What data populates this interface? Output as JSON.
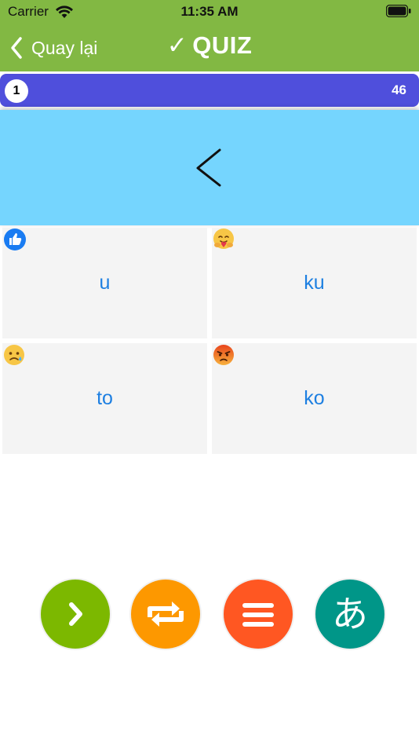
{
  "status": {
    "carrier": "Carrier",
    "time": "11:35 AM"
  },
  "nav": {
    "back_label": "Quay lại",
    "title_check": "✓",
    "title": "QUIZ"
  },
  "progress": {
    "current": "1",
    "total": "46"
  },
  "question": {
    "glyph": "ku-hiragana"
  },
  "answers": [
    {
      "text": "u",
      "reaction": "thumbs-up-icon"
    },
    {
      "text": "ku",
      "reaction": "hug-emoji-icon"
    },
    {
      "text": "to",
      "reaction": "sad-emoji-icon"
    },
    {
      "text": "ko",
      "reaction": "angry-emoji-icon"
    }
  ],
  "actions": [
    {
      "name": "next",
      "color": "#7cb800"
    },
    {
      "name": "repeat",
      "color": "#fd9800"
    },
    {
      "name": "menu",
      "color": "#ff5722"
    },
    {
      "name": "hiragana",
      "label": "あ",
      "color": "#009688"
    }
  ],
  "colors": {
    "header": "#82b843",
    "progress": "#4f4fdc",
    "question_bg": "#75d5fe",
    "answer_text": "#1d7fe1"
  }
}
